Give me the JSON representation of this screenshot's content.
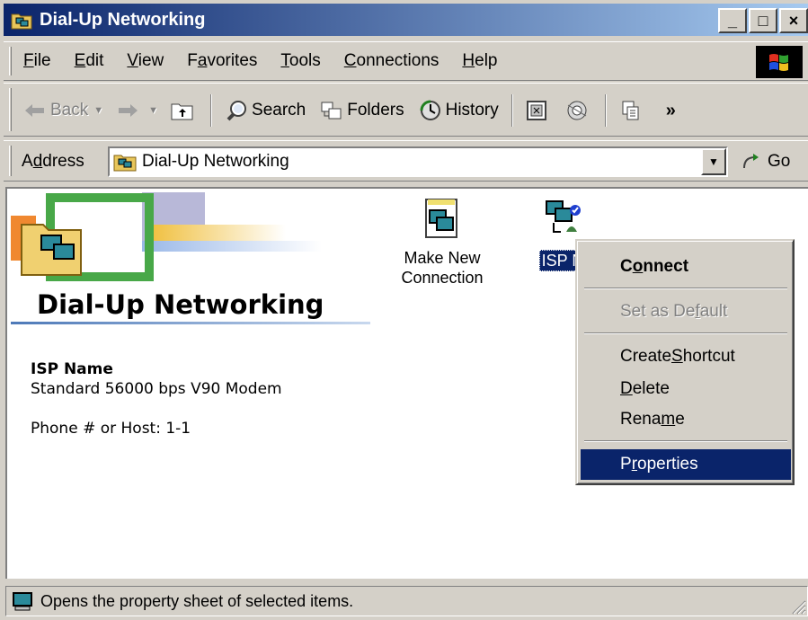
{
  "window": {
    "title": "Dial-Up Networking",
    "controls": {
      "minimize": "_",
      "maximize": "□",
      "close": "×"
    }
  },
  "menubar": {
    "items": [
      {
        "label": "File",
        "accel": "F",
        "rest": "ile"
      },
      {
        "label": "Edit",
        "accel": "E",
        "rest": "dit"
      },
      {
        "label": "View",
        "accel": "V",
        "rest": "iew"
      },
      {
        "label": "Favorites",
        "pre": "F",
        "accel": "a",
        "rest": "vorites"
      },
      {
        "label": "Tools",
        "accel": "T",
        "rest": "ools"
      },
      {
        "label": "Connections",
        "accel": "C",
        "rest": "onnections"
      },
      {
        "label": "Help",
        "accel": "H",
        "rest": "elp"
      }
    ]
  },
  "toolbar": {
    "back": "Back",
    "search": "Search",
    "folders": "Folders",
    "history": "History",
    "chevron": "»"
  },
  "address": {
    "label_pre": "A",
    "label_accel": "d",
    "label_rest": "dress",
    "value": "Dial-Up Networking",
    "go": "Go"
  },
  "content": {
    "folder_title": "Dial-Up Networking",
    "details": {
      "name": "ISP Name",
      "modem": "Standard 56000 bps V90 Modem",
      "phone": "Phone # or Host: 1-1"
    },
    "icons": [
      {
        "line1": "Make New",
        "line2": "Connection"
      },
      {
        "label": "ISP N"
      }
    ]
  },
  "context_menu": {
    "connect": {
      "pre": "C",
      "accel": "o",
      "rest": "nnect"
    },
    "set_default": {
      "pre": "Set as De",
      "accel": "f",
      "rest": "ault"
    },
    "create_shortcut": {
      "pre": "Create ",
      "accel": "S",
      "rest": "hortcut"
    },
    "delete": {
      "pre": "",
      "accel": "D",
      "rest": "elete"
    },
    "rename": {
      "pre": "Rena",
      "accel": "m",
      "rest": "e"
    },
    "properties": {
      "pre": "P",
      "accel": "r",
      "rest": "operties"
    }
  },
  "statusbar": {
    "text": "Opens the property sheet of selected items."
  },
  "colors": {
    "title_start": "#0a246a",
    "title_end": "#a6caf0",
    "highlight": "#0a246a",
    "face": "#d4d0c8"
  }
}
